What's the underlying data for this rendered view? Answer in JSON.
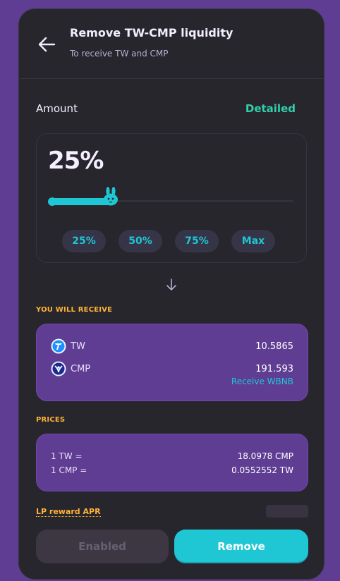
{
  "header": {
    "title": "Remove TW-CMP liquidity",
    "subtitle": "To receive TW and CMP"
  },
  "amount": {
    "label": "Amount",
    "detailed_label": "Detailed",
    "percent_display": "25%",
    "slider_value_percent": 25,
    "quick_buttons": [
      "25%",
      "50%",
      "75%",
      "Max"
    ]
  },
  "receive": {
    "section_label": "YOU WILL RECEIVE",
    "tokens": [
      {
        "symbol": "TW",
        "amount": "10.5865",
        "icon": "tw-token-icon"
      },
      {
        "symbol": "CMP",
        "amount": "191.593",
        "icon": "cmp-token-icon"
      }
    ],
    "receive_wbnb_label": "Receive WBNB"
  },
  "prices": {
    "section_label": "PRICES",
    "rows": [
      {
        "label": "1 TW =",
        "value": "18.0978 CMP"
      },
      {
        "label": "1 CMP =",
        "value": "0.0552552 TW"
      }
    ]
  },
  "lp_reward": {
    "label": "LP reward APR"
  },
  "actions": {
    "enabled_label": "Enabled",
    "remove_label": "Remove"
  },
  "colors": {
    "accent": "#1fc7d4",
    "detailed": "#31d0aa",
    "warning_label": "#ffb237",
    "background": "#5f3d93",
    "card": "#27262c"
  }
}
